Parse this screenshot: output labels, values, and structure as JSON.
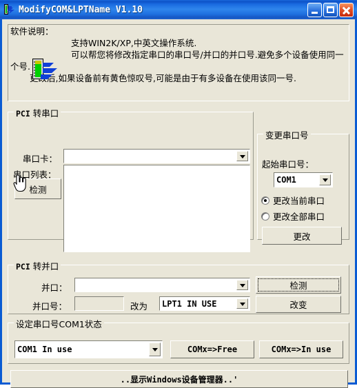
{
  "window": {
    "title": "ModifyCOM&LPTName V1.10",
    "icon": "app-icon",
    "accent_titlebar": "#1E6FDF",
    "client_bg": "#E9E6D8",
    "buttons": {
      "minimize": "minimize",
      "maximize": "maximize",
      "close": "close"
    }
  },
  "description": {
    "heading": "软件说明：",
    "icon": "com-port-icon",
    "line1": "支持WIN2K/XP,中英文操作系统.",
    "line2": "可以帮您将修改指定串口的串口号/并口的并口号.避免多个设备使用同一个号.",
    "line3": "更改后,如果设备前有黄色惊叹号,可能是由于有多设备在使用该同一号."
  },
  "serial_group": {
    "title_prefix": "PCI",
    "title_suffix": "转串口",
    "card_label": "串口卡：",
    "card_value": "",
    "list_label": "串口列表：",
    "list_items": [],
    "detect_button": "检测"
  },
  "change_group": {
    "title": "变更串口号",
    "start_label": "起始串口号：",
    "start_value": "COM1",
    "radio_current": "更改当前串口",
    "radio_all": "更改全部串口",
    "selected_radio": "更改当前串口",
    "change_button": "更改"
  },
  "parallel_group": {
    "title_prefix": "PCI",
    "title_suffix": "转并口",
    "port_label": "并口：",
    "port_value": "",
    "detect_button": "检测",
    "portnum_label": "并口号：",
    "portnum_value": "",
    "changeto_label": "改为",
    "changeto_value": "LPT1 IN USE",
    "change_button": "改变"
  },
  "status_group": {
    "title": "设定串口号COM1状态",
    "status_value": "COM1 In use",
    "free_button": "COMx=>Free",
    "inuse_button": "COMx=>In use"
  },
  "footer": {
    "device_manager_button": "..显示Windows设备管理器..'"
  }
}
